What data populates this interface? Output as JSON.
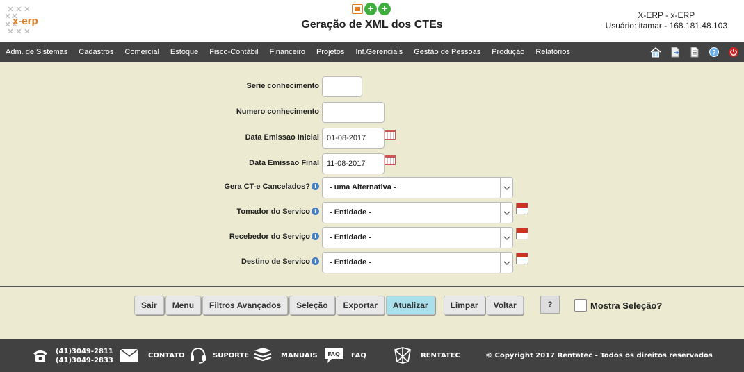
{
  "header": {
    "logo_text": "x-erp",
    "title": "Geração de XML dos CTEs",
    "system": "X-ERP - x-ERP",
    "user_line": "Usuário: itamar - 168.181.48.103"
  },
  "menu": {
    "items": [
      {
        "label": "Adm. de Sistemas"
      },
      {
        "label": "Cadastros"
      },
      {
        "label": "Comercial"
      },
      {
        "label": "Estoque"
      },
      {
        "label": "Fisco-Contábil"
      },
      {
        "label": "Financeiro"
      },
      {
        "label": "Projetos"
      },
      {
        "label": "Inf.Gerenciais"
      },
      {
        "label": "Gestão de Pessoas"
      },
      {
        "label": "Produção"
      },
      {
        "label": "Relatórios"
      }
    ],
    "icons": [
      "home-icon",
      "document-arrow-icon",
      "document-icon",
      "help-globe-icon",
      "power-icon"
    ]
  },
  "form": {
    "serie_label": "Serie conhecimento",
    "serie_value": "",
    "numero_label": "Numero conhecimento",
    "numero_value": "",
    "data_inicial_label": "Data Emissao Inicial",
    "data_inicial_value": "01-08-2017",
    "data_final_label": "Data Emissao Final",
    "data_final_value": "11-08-2017",
    "cancelados_label": "Gera CT-e Cancelados?",
    "cancelados_value": "- uma Alternativa -",
    "tomador_label": "Tomador do Servico",
    "tomador_value": "- Entidade -",
    "recebedor_label": "Recebedor do Serviço",
    "recebedor_value": "- Entidade -",
    "destino_label": "Destino de Servico",
    "destino_value": "- Entidade -"
  },
  "buttons": {
    "sair": "Sair",
    "menu": "Menu",
    "filtros": "Filtros Avançados",
    "selecao": "Seleção",
    "exportar": "Exportar",
    "atualizar": "Atualizar",
    "limpar": "Limpar",
    "voltar": "Voltar",
    "help": "?",
    "mostra_selecao": "Mostra Seleção?"
  },
  "footer": {
    "phone1": "(41)3049-2811",
    "phone2": "(41)3049-2833",
    "contato": "CONTATO",
    "suporte": "SUPORTE",
    "manuais": "MANUAIS",
    "faq_badge": "FAQ",
    "faq": "FAQ",
    "rentatec": "RENTATEC",
    "copyright": "© Copyright 2017 Rentatec - Todos os direitos reservados"
  },
  "colors": {
    "background": "#ecebd1",
    "menubar": "#434343",
    "primary_button": "#a9e0ec",
    "logo_accent": "#e07a1f"
  }
}
